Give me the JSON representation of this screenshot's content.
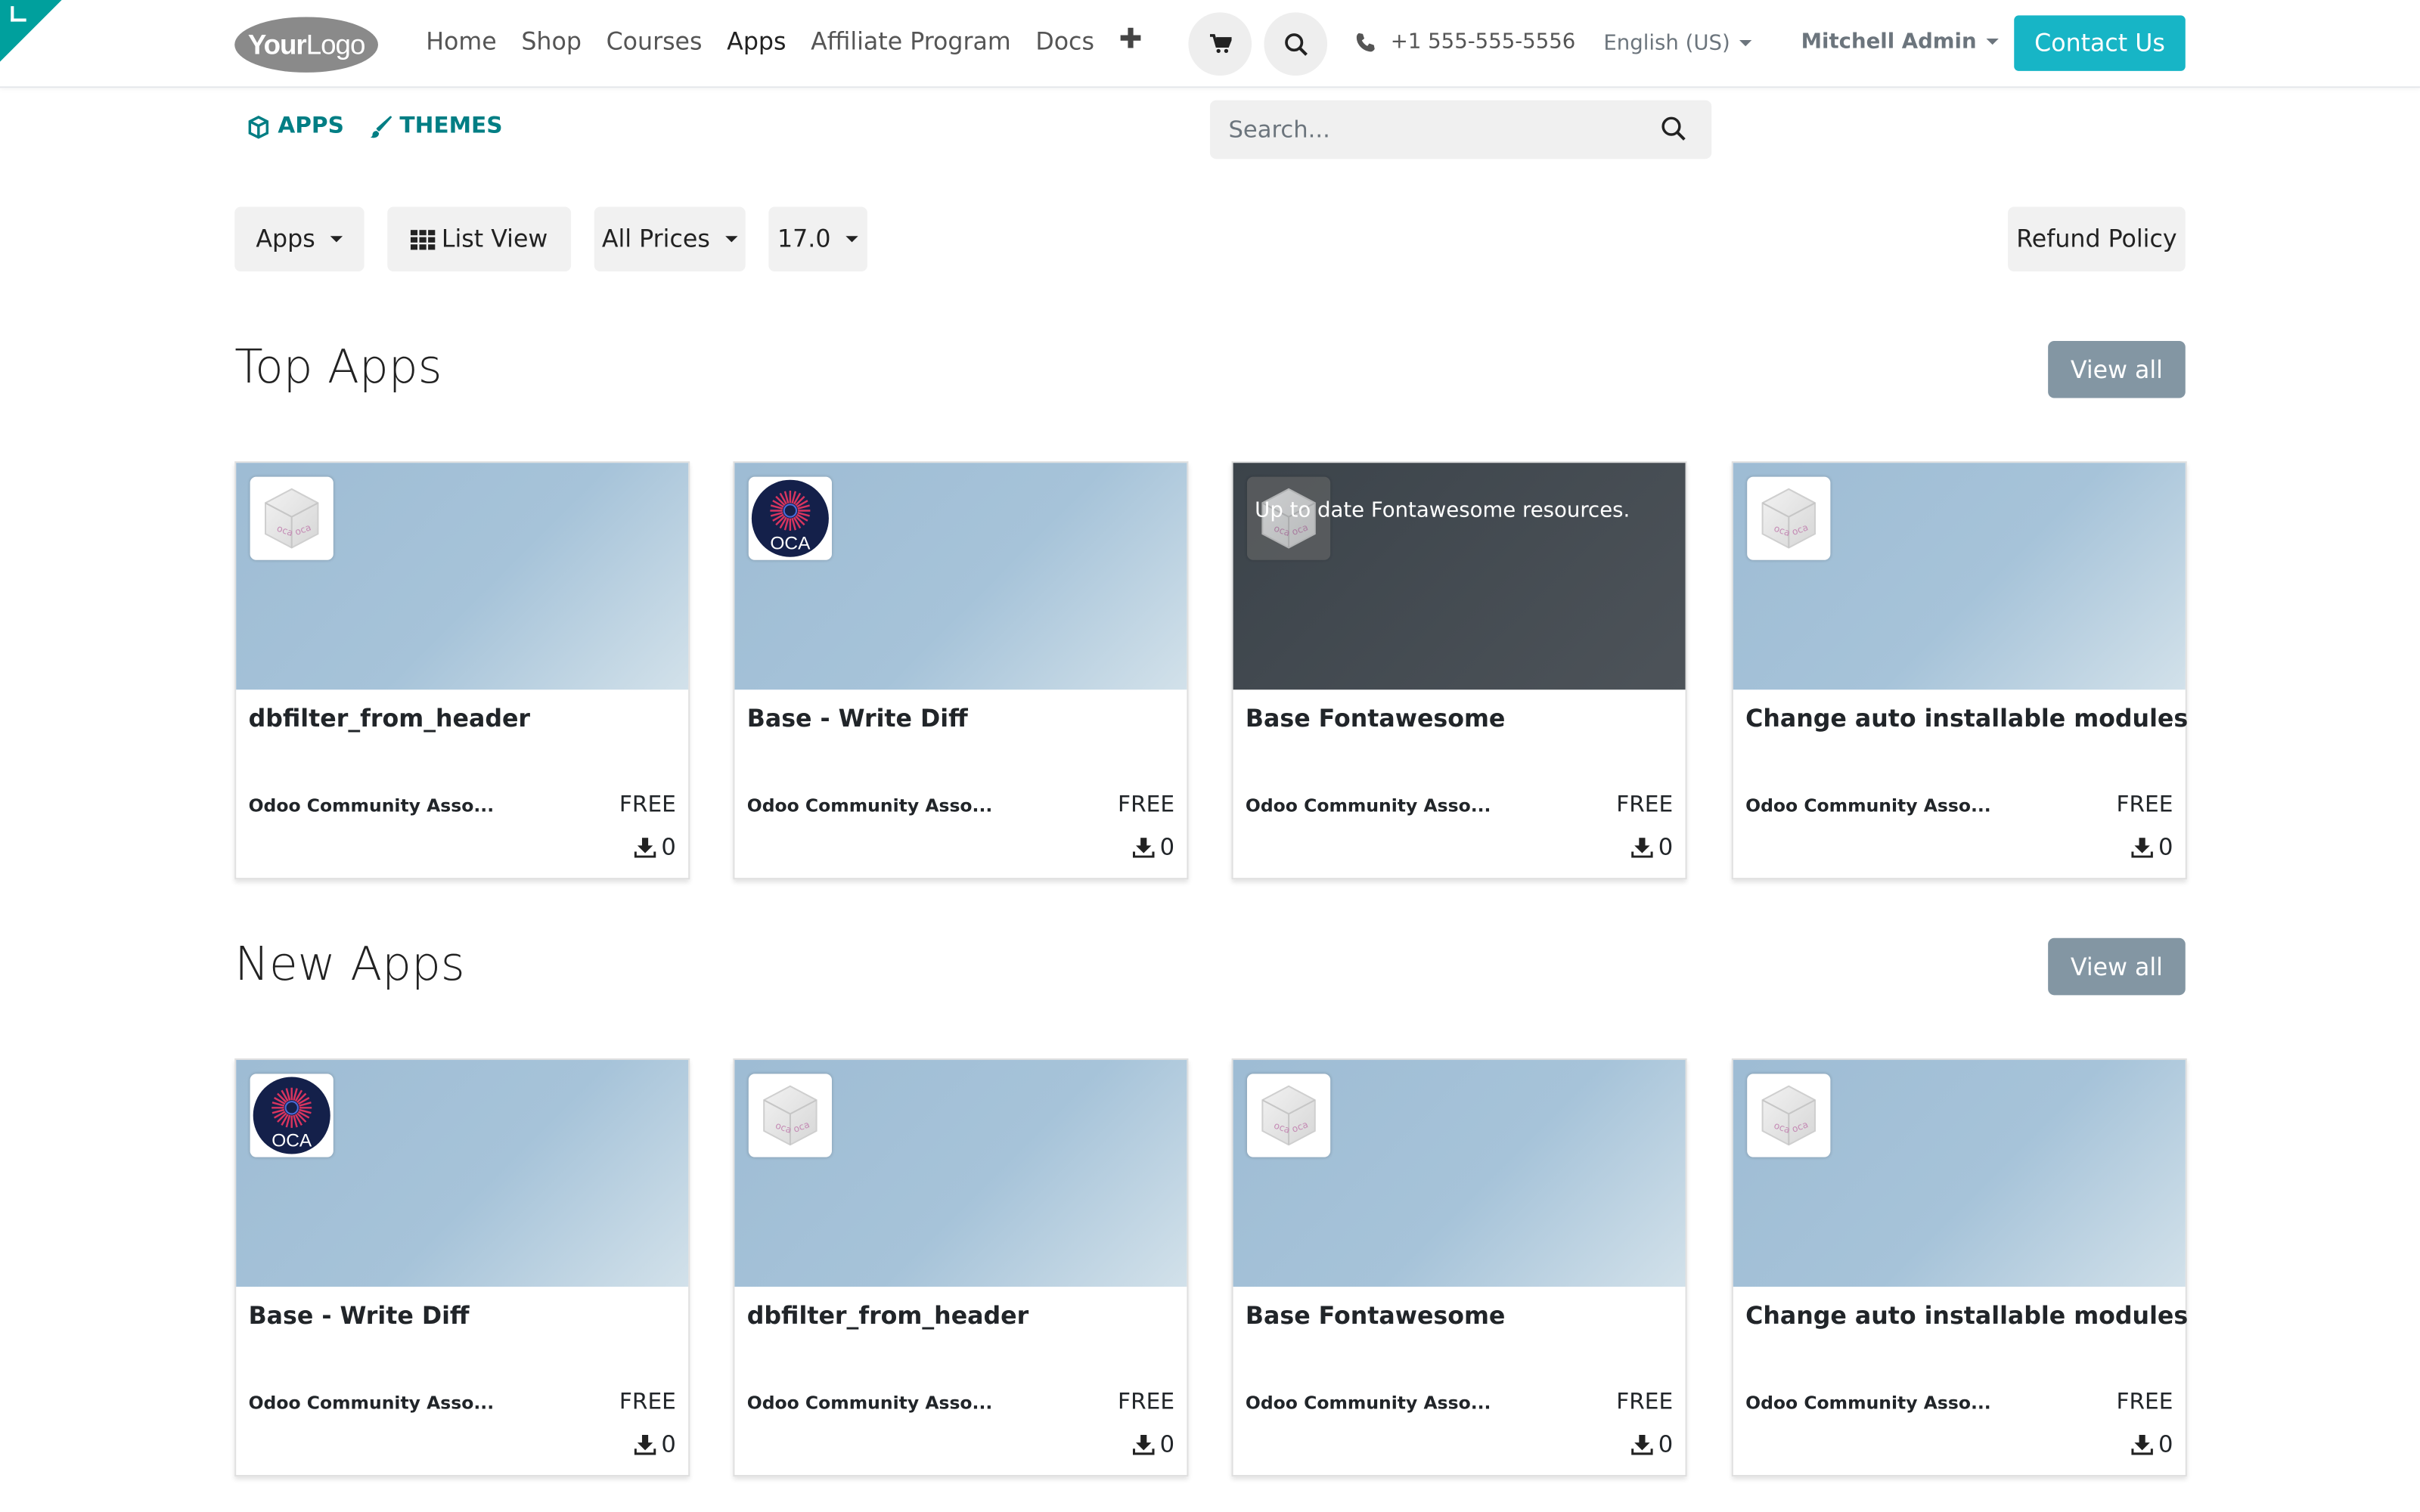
{
  "header": {
    "logo_text_bold": "Your",
    "logo_text": "Logo",
    "nav": [
      "Home",
      "Shop",
      "Courses",
      "Apps",
      "Affiliate Program",
      "Docs"
    ],
    "active_nav": "Apps",
    "phone": "+1 555-555-5556",
    "language": "English (US)",
    "user": "Mitchell Admin",
    "contact_label": "Contact Us"
  },
  "subnav": {
    "apps_label": "APPS",
    "themes_label": "THEMES"
  },
  "search": {
    "placeholder": "Search..."
  },
  "filters": {
    "category": "Apps",
    "view": "List View",
    "price": "All Prices",
    "version": "17.0",
    "refund": "Refund Policy"
  },
  "sections": [
    {
      "title": "Top Apps",
      "view_all": "View all",
      "cards": [
        {
          "name": "dbfilter_from_header",
          "author": "Odoo Community Asso...",
          "price": "FREE",
          "downloads": "0",
          "icon": "oca-cube-icon",
          "description": ""
        },
        {
          "name": "Base - Write Diff",
          "author": "Odoo Community Asso...",
          "price": "FREE",
          "downloads": "0",
          "icon": "oca-logo-icon",
          "description": ""
        },
        {
          "name": "Base Fontawesome",
          "author": "Odoo Community Asso...",
          "price": "FREE",
          "downloads": "0",
          "icon": "oca-cube-icon",
          "description": "Up to date Fontawesome resources."
        },
        {
          "name": "Change auto installable modules",
          "author": "Odoo Community Asso...",
          "price": "FREE",
          "downloads": "0",
          "icon": "oca-cube-icon",
          "description": ""
        }
      ]
    },
    {
      "title": "New Apps",
      "view_all": "View all",
      "cards": [
        {
          "name": "Base - Write Diff",
          "author": "Odoo Community Asso...",
          "price": "FREE",
          "downloads": "0",
          "icon": "oca-logo-icon",
          "description": ""
        },
        {
          "name": "dbfilter_from_header",
          "author": "Odoo Community Asso...",
          "price": "FREE",
          "downloads": "0",
          "icon": "oca-cube-icon",
          "description": ""
        },
        {
          "name": "Base Fontawesome",
          "author": "Odoo Community Asso...",
          "price": "FREE",
          "downloads": "0",
          "icon": "oca-cube-icon",
          "description": ""
        },
        {
          "name": "Change auto installable modules",
          "author": "Odoo Community Asso...",
          "price": "FREE",
          "downloads": "0",
          "icon": "oca-cube-icon",
          "description": ""
        }
      ]
    }
  ],
  "colors": {
    "brand_teal": "#017e84",
    "contact_button": "#17b5c6",
    "view_all_button": "#8396a3"
  }
}
